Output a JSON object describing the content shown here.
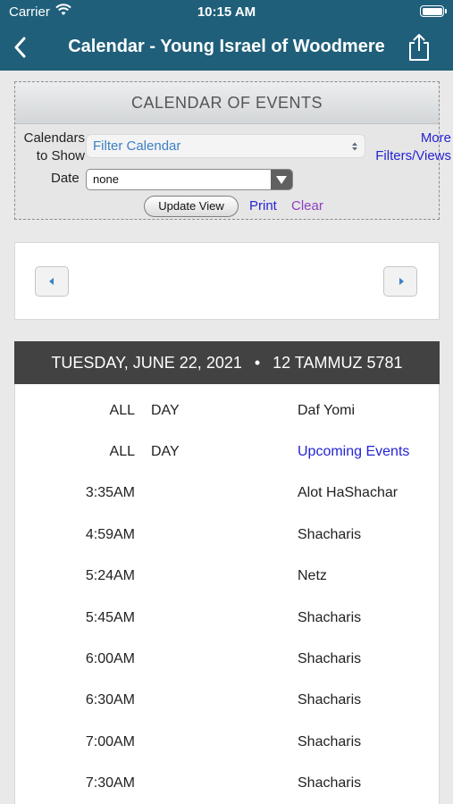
{
  "status_bar": {
    "carrier": "Carrier",
    "time": "10:15 AM"
  },
  "nav": {
    "title": "Calendar - Young Israel of Woodmere"
  },
  "filter": {
    "header": "CALENDAR OF EVENTS",
    "calendars_label_line1": "Calendars",
    "calendars_label_line2": "to Show",
    "calendar_select_value": "Filter Calendar",
    "more_line1": "More",
    "more_line2": "Filters/Views",
    "date_label": "Date",
    "date_select_value": "none",
    "update_button": "Update View",
    "print_link": "Print",
    "clear_link": "Clear"
  },
  "day": {
    "gregorian": "TUESDAY, JUNE 22, 2021",
    "separator": "•",
    "hebrew": "12 TAMMUZ 5781"
  },
  "all_day_events": [
    {
      "time_a": "ALL",
      "time_b": "DAY",
      "name": "Daf Yomi",
      "is_link": false
    },
    {
      "time_a": "ALL",
      "time_b": "DAY",
      "name": "Upcoming Events",
      "is_link": true
    }
  ],
  "timed_events": [
    {
      "time": "3:35AM",
      "name": "Alot HaShachar"
    },
    {
      "time": "4:59AM",
      "name": "Shacharis"
    },
    {
      "time": "5:24AM",
      "name": "Netz"
    },
    {
      "time": "5:45AM",
      "name": "Shacharis"
    },
    {
      "time": "6:00AM",
      "name": "Shacharis"
    },
    {
      "time": "6:30AM",
      "name": "Shacharis"
    },
    {
      "time": "7:00AM",
      "name": "Shacharis"
    },
    {
      "time": "7:30AM",
      "name": "Shacharis"
    }
  ],
  "colors": {
    "nav_bar": "#1f5f7a",
    "link_blue": "#2424d4",
    "link_visited": "#8c3fc1",
    "day_header": "#424242"
  }
}
